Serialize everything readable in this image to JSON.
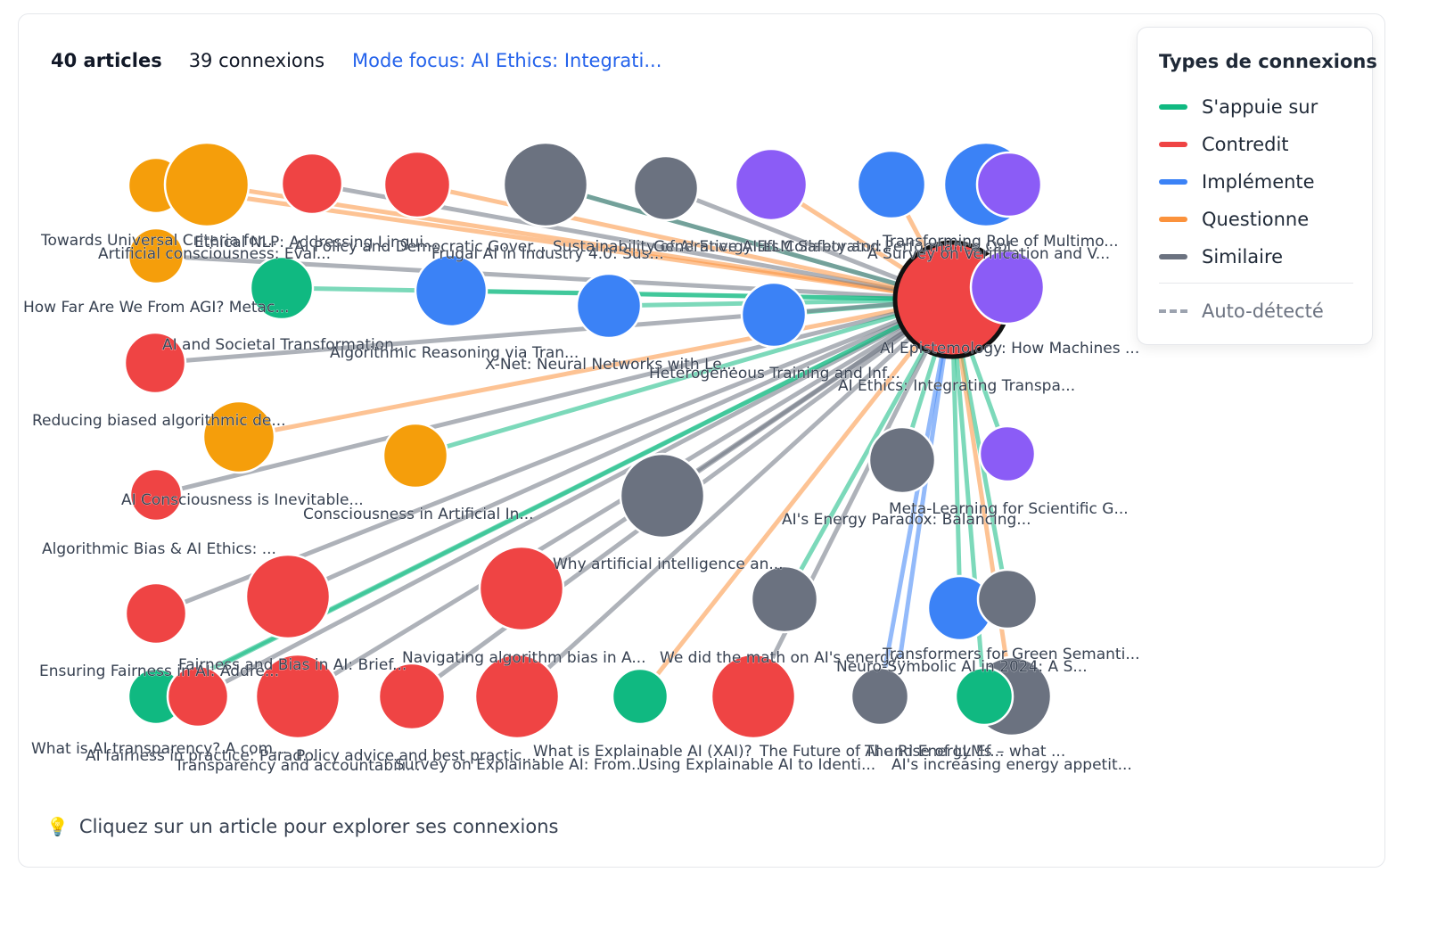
{
  "header": {
    "articles_count": "40 articles",
    "connections_count": "39 connexions",
    "focus_mode": "Mode focus: AI Ethics: Integrati..."
  },
  "legend": {
    "title": "Types de connexions",
    "items": [
      {
        "label": "S'appuie sur",
        "color": "#10b981"
      },
      {
        "label": "Contredit",
        "color": "#ef4444"
      },
      {
        "label": "Implémente",
        "color": "#3b82f6"
      },
      {
        "label": "Questionne",
        "color": "#fb923c"
      },
      {
        "label": "Similaire",
        "color": "#6b7280"
      }
    ],
    "auto_label": "Auto-détecté"
  },
  "hint": {
    "icon": "lightbulb-icon",
    "text": "Cliquez sur un article pour explorer ses connexions"
  },
  "colors": {
    "orange": "#f59e0b",
    "red": "#ef4444",
    "gray": "#6b7280",
    "purple": "#8b5cf6",
    "blue": "#3b82f6",
    "green": "#10b981"
  },
  "nodes": [
    {
      "label": "Towards Universal Criteria for...",
      "color": "orange"
    },
    {
      "label": "Ethical NLP: Addressing Lingui...",
      "color": "orange"
    },
    {
      "label": "AI Policy and Democratic Gover...",
      "color": "red"
    },
    {
      "label": "Frugal AI in Industry 4.0: Sus...",
      "color": "red"
    },
    {
      "label": "Sustainability of AI Energy Ef...",
      "color": "gray"
    },
    {
      "label": "Generative AI as Collaborator:...",
      "color": "gray"
    },
    {
      "label": "LLM Safety and Performance Opt...",
      "color": "purple"
    },
    {
      "label": "A Survey on Verification and V...",
      "color": "blue"
    },
    {
      "label": "Transforming Role of Multimo...",
      "color": "blue"
    },
    {
      "label": "",
      "color": "purple"
    },
    {
      "label": "Artificial consciousness: Eval...",
      "color": "orange"
    },
    {
      "label": "AI and Societal Transformation...",
      "color": "green"
    },
    {
      "label": "Algorithmic Reasoning via Tran...",
      "color": "blue"
    },
    {
      "label": "X-Net: Neural Networks with Le...",
      "color": "blue"
    },
    {
      "label": "Heterogeneous Training and Inf...",
      "color": "blue"
    },
    {
      "label": "AI Ethics: Integrating Transpa...",
      "color": "red"
    },
    {
      "label": "AI Epistemology: How Machines ...",
      "color": "purple"
    },
    {
      "label": "How Far Are We From AGI? Metac...",
      "color": "red"
    },
    {
      "label": "Reducing biased algorithmic de...",
      "color": "orange"
    },
    {
      "label": "AI Consciousness is Inevitable...",
      "color": "red"
    },
    {
      "label": "Consciousness in Artificial In...",
      "color": "orange"
    },
    {
      "label": "Why artificial intelligence an...",
      "color": "gray"
    },
    {
      "label": "AI's Energy Paradox: Balancing...",
      "color": "gray"
    },
    {
      "label": "Meta-Learning for Scientific G...",
      "color": "purple"
    },
    {
      "label": "Algorithmic Bias & AI Ethics: ...",
      "color": "red"
    },
    {
      "label": "Fairness and Bias in AI: Brief...",
      "color": "red"
    },
    {
      "label": "Navigating algorithm bias in A...",
      "color": "red"
    },
    {
      "label": "We did the math on AI's energy...",
      "color": "gray"
    },
    {
      "label": "Transformers for Green Semanti...",
      "color": "blue"
    },
    {
      "label": "Neuro-Symbolic AI in 2024: A S...",
      "color": "gray"
    },
    {
      "label": "Ensuring Fairness in AI: Addre...",
      "color": "green"
    },
    {
      "label": "AI fairness in practice: Parad...",
      "color": "red"
    },
    {
      "label": "Policy advice and best practic...",
      "color": "red"
    },
    {
      "label": "Transparency and accountabili...",
      "color": "red"
    },
    {
      "label": "Survey on Explainable AI: From...",
      "color": "red"
    },
    {
      "label": "What is Explainable AI (XAI)?",
      "color": "green"
    },
    {
      "label": "Using Explainable AI to Identi...",
      "color": "red"
    },
    {
      "label": "The Future of AI and Energy Ef...",
      "color": "gray"
    },
    {
      "label": "The Rise of LLMs – what ...",
      "color": "gray"
    },
    {
      "label": "AI's increasing energy appetit...",
      "color": "green"
    },
    {
      "label": "What is AI transparency? A com...",
      "color": "green"
    }
  ],
  "edges": [
    {
      "from": 0,
      "type": "Questionne"
    },
    {
      "from": 1,
      "type": "Questionne"
    },
    {
      "from": 2,
      "type": "Similaire"
    },
    {
      "from": 3,
      "type": "Questionne"
    },
    {
      "from": 4,
      "type": "S'appuie sur"
    },
    {
      "from": 4,
      "type": "Similaire"
    },
    {
      "from": 5,
      "type": "Similaire"
    },
    {
      "from": 6,
      "type": "Questionne"
    },
    {
      "from": 7,
      "type": "Questionne"
    },
    {
      "from": 10,
      "type": "Similaire"
    },
    {
      "from": 11,
      "type": "S'appuie sur"
    },
    {
      "from": 12,
      "type": "S'appuie sur"
    },
    {
      "from": 13,
      "type": "S'appuie sur"
    },
    {
      "from": 14,
      "type": "S'appuie sur"
    },
    {
      "from": 17,
      "type": "Similaire"
    },
    {
      "from": 18,
      "type": "Questionne"
    },
    {
      "from": 19,
      "type": "Similaire"
    },
    {
      "from": 20,
      "type": "S'appuie sur"
    },
    {
      "from": 21,
      "type": "Similaire"
    },
    {
      "from": 22,
      "type": "S'appuie sur"
    },
    {
      "from": 23,
      "type": "S'appuie sur"
    },
    {
      "from": 24,
      "type": "Similaire"
    },
    {
      "from": 25,
      "type": "Similaire"
    },
    {
      "from": 26,
      "type": "Similaire"
    },
    {
      "from": 27,
      "type": "S'appuie sur"
    },
    {
      "from": 28,
      "type": "S'appuie sur"
    },
    {
      "from": 29,
      "type": "S'appuie sur"
    },
    {
      "from": 30,
      "type": "S'appuie sur"
    },
    {
      "from": 31,
      "type": "Similaire"
    },
    {
      "from": 32,
      "type": "Similaire"
    },
    {
      "from": 33,
      "type": "Similaire"
    },
    {
      "from": 34,
      "type": "Similaire"
    },
    {
      "from": 35,
      "type": "Questionne"
    },
    {
      "from": 36,
      "type": "Similaire"
    },
    {
      "from": 37,
      "type": "Implémente"
    },
    {
      "from": 38,
      "type": "Questionne"
    },
    {
      "from": 39,
      "type": "S'appuie sur"
    },
    {
      "from": 21,
      "type": "S'appuie sur"
    },
    {
      "from": 12,
      "type": "Implémente"
    }
  ]
}
